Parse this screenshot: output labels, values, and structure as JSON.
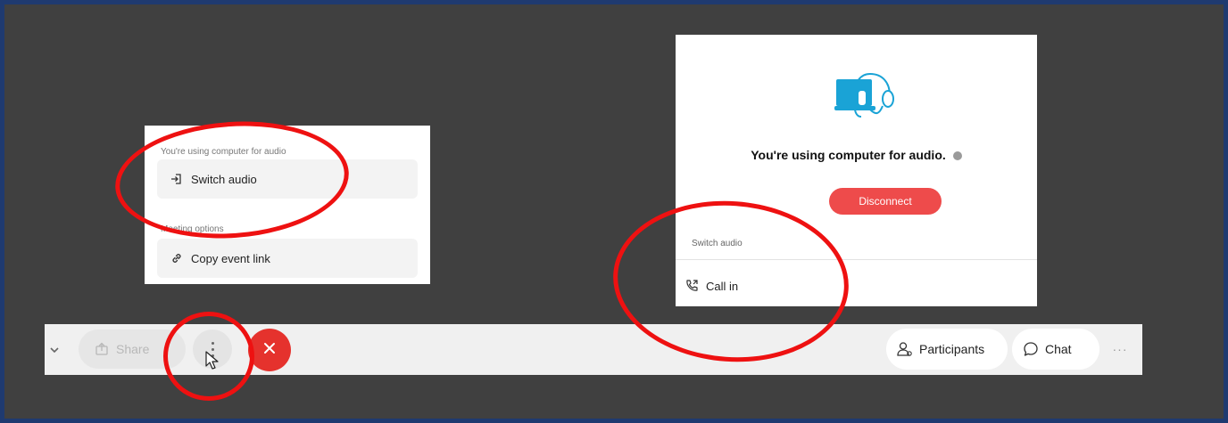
{
  "menu": {
    "audio_section_label": "You're using computer for audio",
    "switch_audio_label": "Switch audio",
    "meeting_section_label": "Meeting options",
    "copy_link_label": "Copy event link"
  },
  "audio_dialog": {
    "status": "You're using computer for audio.",
    "disconnect_label": "Disconnect",
    "switch_audio_label": "Switch audio",
    "call_in_label": "Call in"
  },
  "toolbar": {
    "share_label": "Share",
    "participants_label": "Participants",
    "chat_label": "Chat",
    "overflow_label": "···"
  },
  "colors": {
    "frame": "#1f3a70",
    "stage": "#404040",
    "disconnect": "#ee4b4b",
    "end_call": "#e5322d",
    "annotation": "#ee1111",
    "illustration": "#1aa3d6"
  },
  "icons": {
    "switch_audio": "switch-audio-icon",
    "copy_link": "link-icon",
    "call_in": "phone-icon",
    "share": "share-icon",
    "more": "more-vertical-icon",
    "end_call": "close-icon",
    "participants": "participants-icon",
    "chat": "chat-bubble-icon"
  }
}
